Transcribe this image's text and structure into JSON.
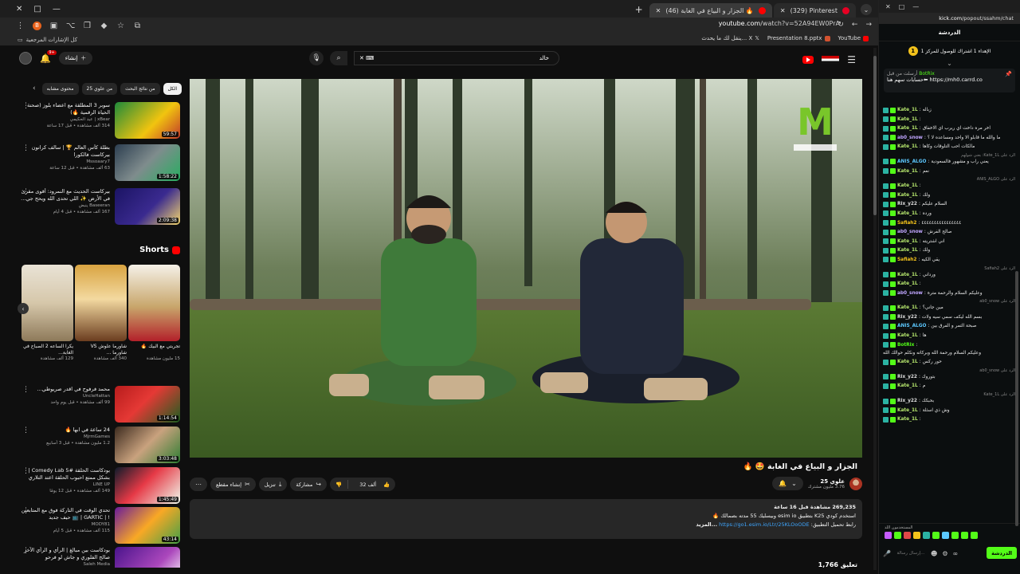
{
  "browser": {
    "tabs": [
      {
        "label": "(46) الجزار و البياع في الغابة 🔥",
        "color": "#ff0000",
        "active": true
      },
      {
        "label": "(329) Pinterest",
        "color": "#e60023",
        "active": false
      }
    ],
    "address": {
      "host": "youtube.com",
      "path": "/watch?v=52A94EW0PrA"
    },
    "bookmarks_all": "كل الإشارات المرجعية",
    "bookmarks": [
      {
        "label": "YouTube",
        "color": "#ff0000"
      },
      {
        "label": "Presentation 8.pptx",
        "color": "#d35230"
      },
      {
        "label": "ينقل لك ما يحدث... X",
        "color": "#ffffff"
      }
    ]
  },
  "youtube": {
    "create_label": "إنشاء",
    "notif_count": "9+",
    "search_value": "خالد",
    "chips": [
      "الكل",
      "من نتائج البحث",
      "من علوي 25",
      "محتوى مشابه"
    ],
    "recs_top": [
      {
        "title": "سوبر 3 المطلقة مع اعضاء بلوز (صحنة الحياة الرقمية 🔥)",
        "channel": "xBear | عبد الحكيمي",
        "stats": "314 ألف مشاهدة • قبل 17 ساعة",
        "duration": "59:57"
      },
      {
        "title": "بطلة كأس العالم 🏆 | سالف كرانون بيركاست فالكورا",
        "channel": "Mssoaary7",
        "stats": "63 ألف مشاهدة • قبل 12 ساعة",
        "duration": "1:58:22"
      },
      {
        "title": "بيركاست الحديث مع النمرود: أقوى مقرئ في الأرض ✨ اللي تحدى الله ويحح جي...",
        "channel": "Baseeran ينبض",
        "stats": "167 ألف مشاهدة • قبل 4 أيام",
        "duration": "2:09:38"
      }
    ],
    "shorts_title": "Shorts",
    "shorts": [
      {
        "title": "تجربتي مع البيك 🔥",
        "views": "15 مليون مشاهدة"
      },
      {
        "title": "شاورما علوش VS شاورما ...",
        "views": "340 ألف مشاهدة"
      },
      {
        "title": "يكرا الساعه 2 الصباح في الغابة...",
        "views": "129 ألف مشاهدة"
      }
    ],
    "recs_bottom": [
      {
        "title": "محمد فرفوح في اقدر صريوطي...",
        "channel": "UncleHattan",
        "stats": "99 ألف مشاهدة • قبل يوم واحد",
        "duration": "1:14:54"
      },
      {
        "title": "24 ساعة في ابها 🔥",
        "channel": "MjrmGames",
        "stats": "1.2 مليون مشاهدة • قبل 3 أسابيع",
        "duration": "3:03:48"
      },
      {
        "title": "بودكاست الحلقة #5 Comedy Lab | بشكل ممتع احبوب الحلقة اعتد التلاري مع...",
        "channel": "LINE UP",
        "stats": "149 ألف مشاهدة • قبل 12 يومًا",
        "duration": "1:45:49"
      },
      {
        "title": "تحدي الوقت في التاركة فوق مع المتابعين ! | GARTIC | 📺 حيف جديد",
        "channel": "MODY81",
        "stats": "115 ألف مشاهدة • قبل 5 أيام",
        "duration": "43:14"
      },
      {
        "title": "بودكاست بين مبالغ | الرأي و الرأي الآخر صالح الفلوري و جاش لو فرحو",
        "channel": "Saleh Media",
        "stats": "",
        "duration": ""
      }
    ],
    "video": {
      "title": "الجزار و البياع في الغابة 🤩 🔥",
      "channel": "علوي 25",
      "subs": "3.76 مليون مشترك",
      "likes": "32 ألف",
      "share": "مشاركة",
      "download": "تنزيل",
      "clip": "إنشاء مقطع",
      "desc_stats": "269,235 مشاهدة قبل 16 ساعة",
      "desc_line2": "استخدم كودي K25 بتطبيق esim io وبيسليك 55 مدته بصمالك 🔥",
      "desc_link": "https://go1.esim.io/Ltr/25KLOoODE",
      "desc_link_prefix": "رابط تحميل التطبيق:",
      "desc_more": "...المزيد",
      "next_peek": "1,766 تعليق"
    }
  },
  "popout": {
    "url_host": "kick.com",
    "url_path": "/popout/ssahm/chat",
    "chat_title": "الدردشة",
    "goal": "الإهداء 1 اشتراك للوصول للمركز 1",
    "goal_rank": "1",
    "pinned_by": "BotRix",
    "pinned_prefix": "أرسلت من قبل",
    "pinned_text": "حسابات سهم هنا⬅ https://mh0.carrd.co",
    "messages": [
      {
        "user": "Kate_1L",
        "color": "#b7e86e",
        "text": "زباله",
        "reply": ""
      },
      {
        "user": "Kate_1L",
        "color": "#b7e86e",
        "text": "",
        "reply": ""
      },
      {
        "user": "Kate_1L",
        "color": "#b7e86e",
        "text": "اخر مره داخت اي ريرب اي الاخفاق",
        "reply": ""
      },
      {
        "user": "ab0_snow",
        "color": "#c0a6ff",
        "text": "ما والله ما قابلو الا واحد ومساعده لا ؟",
        "reply": ""
      },
      {
        "user": "Kate_1L",
        "color": "#b7e86e",
        "text": "مالكات احب التلوقات وكاها",
        "reply": ""
      },
      {
        "user": "ANIS_ALGO",
        "color": "#5cc8ff",
        "text": "يعني راب و مشهور فالسعودية",
        "reply": "الرد على Kate_1L: يعني شولهم"
      },
      {
        "user": "Kate_1L",
        "color": "#b7e86e",
        "text": "نعم",
        "reply": ""
      },
      {
        "user": "Kate_1L",
        "color": "#b7e86e",
        "text": "",
        "reply": "الرد على ANIS_ALGO"
      },
      {
        "user": "Kate_1L",
        "color": "#b7e86e",
        "text": "ولك",
        "reply": ""
      },
      {
        "user": "Rix_y22",
        "color": "#dddddd",
        "text": "السلام عليكم",
        "reply": ""
      },
      {
        "user": "Kate_1L",
        "color": "#b7e86e",
        "text": "ورده",
        "reply": ""
      },
      {
        "user": "Safiah2",
        "color": "#f3c21b",
        "text": "٤٤٤٤٤٤٤٤٤٤٤٤٤٤٤٤",
        "reply": ""
      },
      {
        "user": "ab0_snow",
        "color": "#c0a6ff",
        "text": "صالح الفرش",
        "reply": ""
      },
      {
        "user": "Kate_1L",
        "color": "#b7e86e",
        "text": "اني اشتريته",
        "reply": ""
      },
      {
        "user": "Kate_1L",
        "color": "#b7e86e",
        "text": "ولك",
        "reply": ""
      },
      {
        "user": "Safiah2",
        "color": "#f3c21b",
        "text": "يقي الكيه",
        "reply": ""
      },
      {
        "user": "Kate_1L",
        "color": "#b7e86e",
        "text": "ورداني",
        "reply": "الرد على Safiah2"
      },
      {
        "user": "Kate_1L",
        "color": "#b7e86e",
        "text": "",
        "reply": ""
      },
      {
        "user": "ab0_snow",
        "color": "#c0a6ff",
        "text": "وعليكم السلام والرحمة مترة",
        "reply": ""
      },
      {
        "user": "Kate_1L",
        "color": "#b7e86e",
        "text": "مين جاني؟",
        "reply": "الرد على ab0_snow"
      },
      {
        "user": "Rix_y22",
        "color": "#dddddd",
        "text": "بسم الله ليكف سمي سيه ولات",
        "reply": ""
      },
      {
        "user": "ANIS_ALGO",
        "color": "#5cc8ff",
        "text": "صبحة التمر و الفرق بين",
        "reply": ""
      },
      {
        "user": "Kate_1L",
        "color": "#b7e86e",
        "text": "ها",
        "reply": ""
      },
      {
        "user": "BotRix",
        "color": "#53fc18",
        "text": "وعليكم السلام ورحمة الله وبركاته ونكلم حوالك الله",
        "reply": ""
      },
      {
        "user": "Kate_1L",
        "color": "#b7e86e",
        "text": "حور ركس",
        "reply": ""
      },
      {
        "user": "Rix_y22",
        "color": "#dddddd",
        "text": "بتوروك",
        "reply": "الرد على ab0_snow"
      },
      {
        "user": "Kate_1L",
        "color": "#b7e86e",
        "text": "م",
        "reply": ""
      },
      {
        "user": "Rix_y22",
        "color": "#dddddd",
        "text": "بحبكك",
        "reply": "الرد على Kate_1L"
      },
      {
        "user": "Kate_1L",
        "color": "#b7e86e",
        "text": "وش ذي اسئلة",
        "reply": ""
      },
      {
        "user": "Kate_1L",
        "color": "#b7e86e",
        "text": "",
        "reply": ""
      }
    ],
    "emote_label": "المستخدمون اللذ",
    "input_placeholder": "إرسال رسالة...",
    "chat_button": "الدردشة"
  }
}
